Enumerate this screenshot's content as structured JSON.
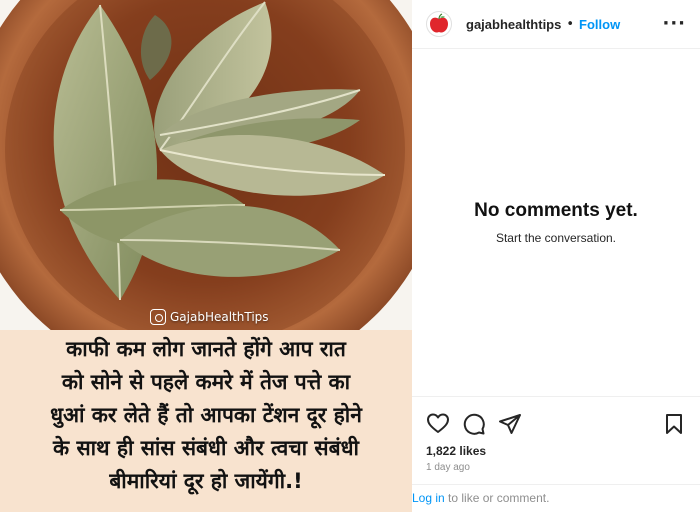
{
  "post": {
    "watermark": "GajabHealthTips",
    "caption_lines": [
      "काफी कम लोग जानते होंगे आप रात",
      "को सोने से पहले कमरे में तेज पत्ते का",
      "धुआं कर लेते हैं तो आपका टेंशन दूर होने",
      "के साथ ही सांस संबंधी और त्वचा संबंधी",
      "बीमारियां दूर हो जायेंगी.!"
    ]
  },
  "header": {
    "username": "gajabhealthtips",
    "separator": "•",
    "follow_label": "Follow",
    "more_label": "···",
    "avatar_text": "Health Tips"
  },
  "comments": {
    "empty_title": "No comments yet.",
    "empty_subtitle": "Start the conversation."
  },
  "actions": {
    "icons": [
      "heart-icon",
      "comment-icon",
      "share-icon",
      "bookmark-icon"
    ]
  },
  "stats": {
    "likes": "1,822 likes",
    "time": "1 day ago"
  },
  "footer": {
    "login_link": "Log in",
    "login_rest": " to like or comment."
  },
  "colors": {
    "accent": "#0095f6",
    "caption_bg": "#f8e3cf"
  }
}
